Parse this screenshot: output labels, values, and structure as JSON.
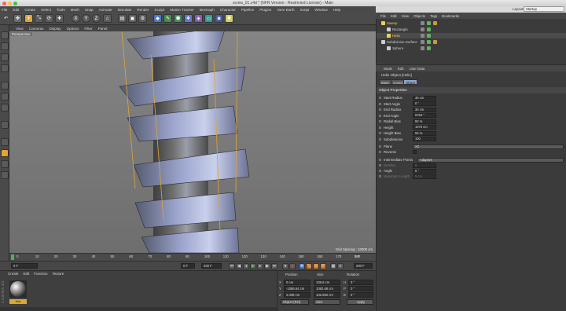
{
  "window": {
    "title": "screw_01.c4d * (NFR Version - Restricted License) - Main",
    "layout_label": "Layout:",
    "layout_value": "Startup"
  },
  "menubar": [
    "File",
    "Edit",
    "Create",
    "Select",
    "Tools",
    "Mesh",
    "Snap",
    "Animate",
    "Simulate",
    "Render",
    "Sculpt",
    "Motion Tracker",
    "MoGraph",
    "Character",
    "Pipeline",
    "Plugins",
    "Oem Earth",
    "Script",
    "Window",
    "Help"
  ],
  "toolbar": {
    "axis_x": "X",
    "axis_y": "Y",
    "axis_z": "Z"
  },
  "viewport": {
    "menu": [
      "View",
      "Cameras",
      "Display",
      "Options",
      "Filter",
      "Panel"
    ],
    "camera_label": "Perspective",
    "grid_spacing": "Grid Spacing : 10000 cm"
  },
  "timeline": {
    "ticks": [
      "0",
      "10",
      "20",
      "30",
      "40",
      "50",
      "60",
      "70",
      "80",
      "90",
      "100",
      "110",
      "120",
      "130",
      "140",
      "150",
      "160",
      "170",
      "180"
    ],
    "current_frame": "0 F",
    "start_field": "0 F",
    "min_field": "0 F",
    "end_field": "200 F",
    "max_field": "200 F"
  },
  "material_manager": {
    "menu": [
      "Create",
      "Edit",
      "Function",
      "Texture"
    ],
    "brand": "CINEMA 4D",
    "material_name": "Mat"
  },
  "coordinates": {
    "headers": {
      "position": "Position",
      "size": "Size",
      "rotation": "Rotation"
    },
    "rows": [
      {
        "axis": "X",
        "pos": "0 cm",
        "size": "106.6 cm",
        "rot_axis": "H",
        "rot": "0 °"
      },
      {
        "axis": "Y",
        "pos": "-1086.84 cm",
        "size": "1082.68 cm",
        "rot_axis": "P",
        "rot": "0 °"
      },
      {
        "axis": "Z",
        "pos": "2.039 cm",
        "size": "102.592 cm",
        "rot_axis": "B",
        "rot": "0 °"
      }
    ],
    "mode_select": "Object (Rel)",
    "size_select": "Size",
    "apply_label": "Apply"
  },
  "object_manager": {
    "menu": [
      "File",
      "Edit",
      "View",
      "Objects",
      "Tags",
      "Bookmarks"
    ],
    "objects": [
      {
        "name": "Sweep",
        "indent": 0,
        "color": "#e8d25a"
      },
      {
        "name": "Rectangle",
        "indent": 1,
        "color": "#cfcfcf"
      },
      {
        "name": "Helix",
        "indent": 1,
        "color": "#e8d25a"
      },
      {
        "name": "Subdivision Surface",
        "indent": 0,
        "color": "#cfcfcf"
      },
      {
        "name": "Sphere",
        "indent": 1,
        "color": "#cfcfcf"
      }
    ]
  },
  "attribute_manager": {
    "menu": [
      "Mode",
      "Edit",
      "User Data"
    ],
    "title": "Helix Object [Helix]",
    "tabs": [
      "Basic",
      "Coord.",
      "Object"
    ],
    "active_tab": "Object",
    "section": "Object Properties",
    "properties": [
      {
        "label": "Start Radius",
        "value": "30 cm",
        "dim": false
      },
      {
        "label": "Start Angle",
        "value": "0 °",
        "dim": false
      },
      {
        "label": "End Radius",
        "value": "30 cm",
        "dim": false
      },
      {
        "label": "End Angle",
        "value": "6760 °",
        "dim": false
      },
      {
        "label": "Radial Bias",
        "value": "50 %",
        "dim": false
      },
      {
        "label": "Height",
        "value": "1070 cm",
        "dim": false
      },
      {
        "label": "Height Bias",
        "value": "50 %",
        "dim": false
      },
      {
        "label": "Subdivisions",
        "value": "100",
        "dim": false
      }
    ],
    "plane_label": "Plane",
    "plane_value": "XZ",
    "reverse_label": "Reverse",
    "intermediate_label": "Intermediate Points",
    "intermediate_value": "Adaptive",
    "number_label": "Number",
    "number_value": "8",
    "angle_label": "Angle",
    "angle_value": "5 °",
    "maxlen_label": "Maximum Length",
    "maxlen_value": "5 cm"
  },
  "colors": {
    "helix_yellow": "#e0a535",
    "screw_blue": "#8c97c4",
    "active_tab": "#8fa7cf"
  }
}
